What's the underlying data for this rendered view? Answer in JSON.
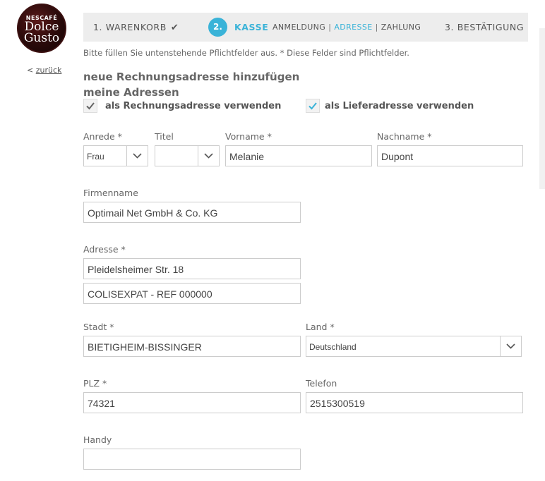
{
  "brand": {
    "line1": "NESCAFÉ",
    "line2": "Dolce",
    "line3": "Gusto"
  },
  "back_link": {
    "prefix": "<",
    "label": "zurück"
  },
  "steps": {
    "step1": "1.  WARENKORB",
    "step2_num": "2.",
    "step2_label": "KASSE",
    "sub": [
      "ANMELDUNG",
      "ADRESSE",
      "ZAHLUNG"
    ],
    "sub_separator": "|",
    "step3": "3.  BESTÄTIGUNG"
  },
  "note": "Bitte füllen Sie untenstehende Pflichtfelder aus.  *  Diese Felder sind Pflichtfelder.",
  "headings": {
    "new_billing": "neue Rechnungsadresse hinzufügen",
    "my_addresses": "meine Adressen"
  },
  "checkboxes": {
    "billing": {
      "label": "als Rechnungsadresse verwenden",
      "checked": true,
      "color": "#666666"
    },
    "shipping": {
      "label": "als Lieferadresse verwenden",
      "checked": true,
      "color": "#3ab3d8"
    }
  },
  "form": {
    "anrede": {
      "label": "Anrede  *",
      "value": "Frau"
    },
    "titel": {
      "label": "Titel",
      "value": ""
    },
    "vorname": {
      "label": "Vorname  *",
      "value": "Melanie"
    },
    "nachname": {
      "label": "Nachname  *",
      "value": "Dupont"
    },
    "firmenname": {
      "label": "Firmenname",
      "value": "Optimail Net GmbH & Co. KG"
    },
    "adresse": {
      "label": "Adresse  *",
      "value1": "Pleidelsheimer Str. 18",
      "value2": "COLISEXPAT - REF 000000"
    },
    "stadt": {
      "label": "Stadt  *",
      "value": "BIETIGHEIM-BISSINGER"
    },
    "land": {
      "label": "Land  *",
      "value": "Deutschland"
    },
    "plz": {
      "label": "PLZ  *",
      "value": "74321"
    },
    "telefon": {
      "label": "Telefon",
      "value": "2515300519"
    },
    "handy": {
      "label": "Handy",
      "value": ""
    }
  },
  "colors": {
    "accent": "#3ab3d8",
    "step_bar": "#ededed"
  }
}
